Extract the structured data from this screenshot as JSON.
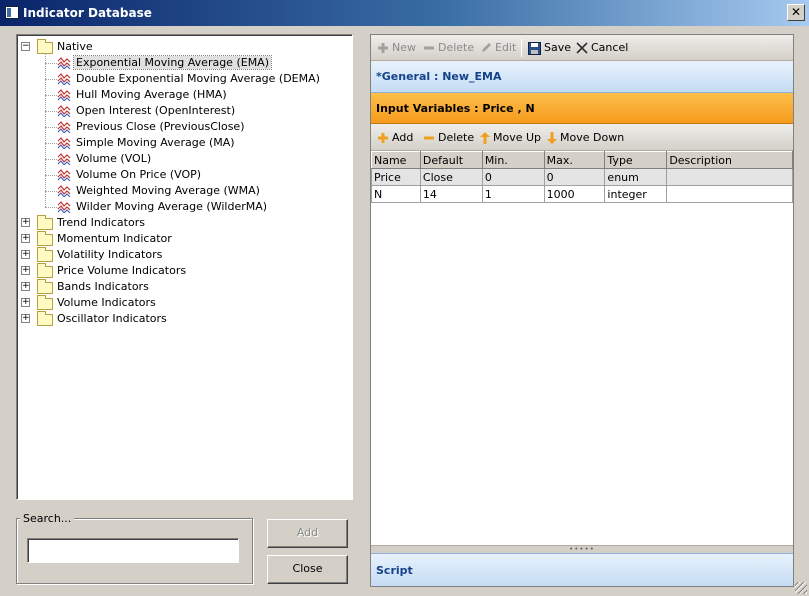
{
  "window": {
    "title": "Indicator Database",
    "close_glyph": "✕"
  },
  "tree": {
    "native": {
      "label": "Native",
      "expander": "−",
      "items": [
        "Exponential Moving Average (EMA)",
        "Double Exponential Moving Average (DEMA)",
        "Hull Moving Average (HMA)",
        "Open Interest (OpenInterest)",
        "Previous Close (PreviousClose)",
        "Simple Moving Average (MA)",
        "Volume (VOL)",
        "Volume On Price (VOP)",
        "Weighted Moving Average (WMA)",
        "Wilder Moving Average (WilderMA)"
      ],
      "selected_index": 0
    },
    "groups": [
      "Trend Indicators",
      "Momentum Indicator",
      "Volatility Indicators",
      "Price Volume Indicators",
      "Bands Indicators",
      "Volume Indicators",
      "Oscillator Indicators"
    ],
    "collapsed_expander": "+"
  },
  "search": {
    "legend": "Search...",
    "value": "",
    "placeholder": ""
  },
  "buttons": {
    "add": "Add",
    "close": "Close"
  },
  "toolbar": {
    "new": "New",
    "delete": "Delete",
    "edit": "Edit",
    "save": "Save",
    "cancel": "Cancel"
  },
  "general": {
    "title": "*General : New_EMA"
  },
  "input_variables": {
    "title": "Input Variables : Price , N",
    "toolbar": {
      "add": "Add",
      "delete": "Delete",
      "move_up": "Move Up",
      "move_down": "Move Down"
    },
    "columns": [
      "Name",
      "Default",
      "Min.",
      "Max.",
      "Type",
      "Description"
    ],
    "rows": [
      [
        "Price",
        "Close",
        "0",
        "0",
        "enum",
        ""
      ],
      [
        "N",
        "14",
        "1",
        "1000",
        "integer",
        ""
      ]
    ]
  },
  "splitter": {
    "grip": "•••••"
  },
  "script": {
    "title": "Script"
  },
  "colors": {
    "title_gradient_start": "#0a246a",
    "general_header": "#c5dcf4",
    "input_vars_header": "#f59b1d",
    "header_text": "#15428b"
  }
}
